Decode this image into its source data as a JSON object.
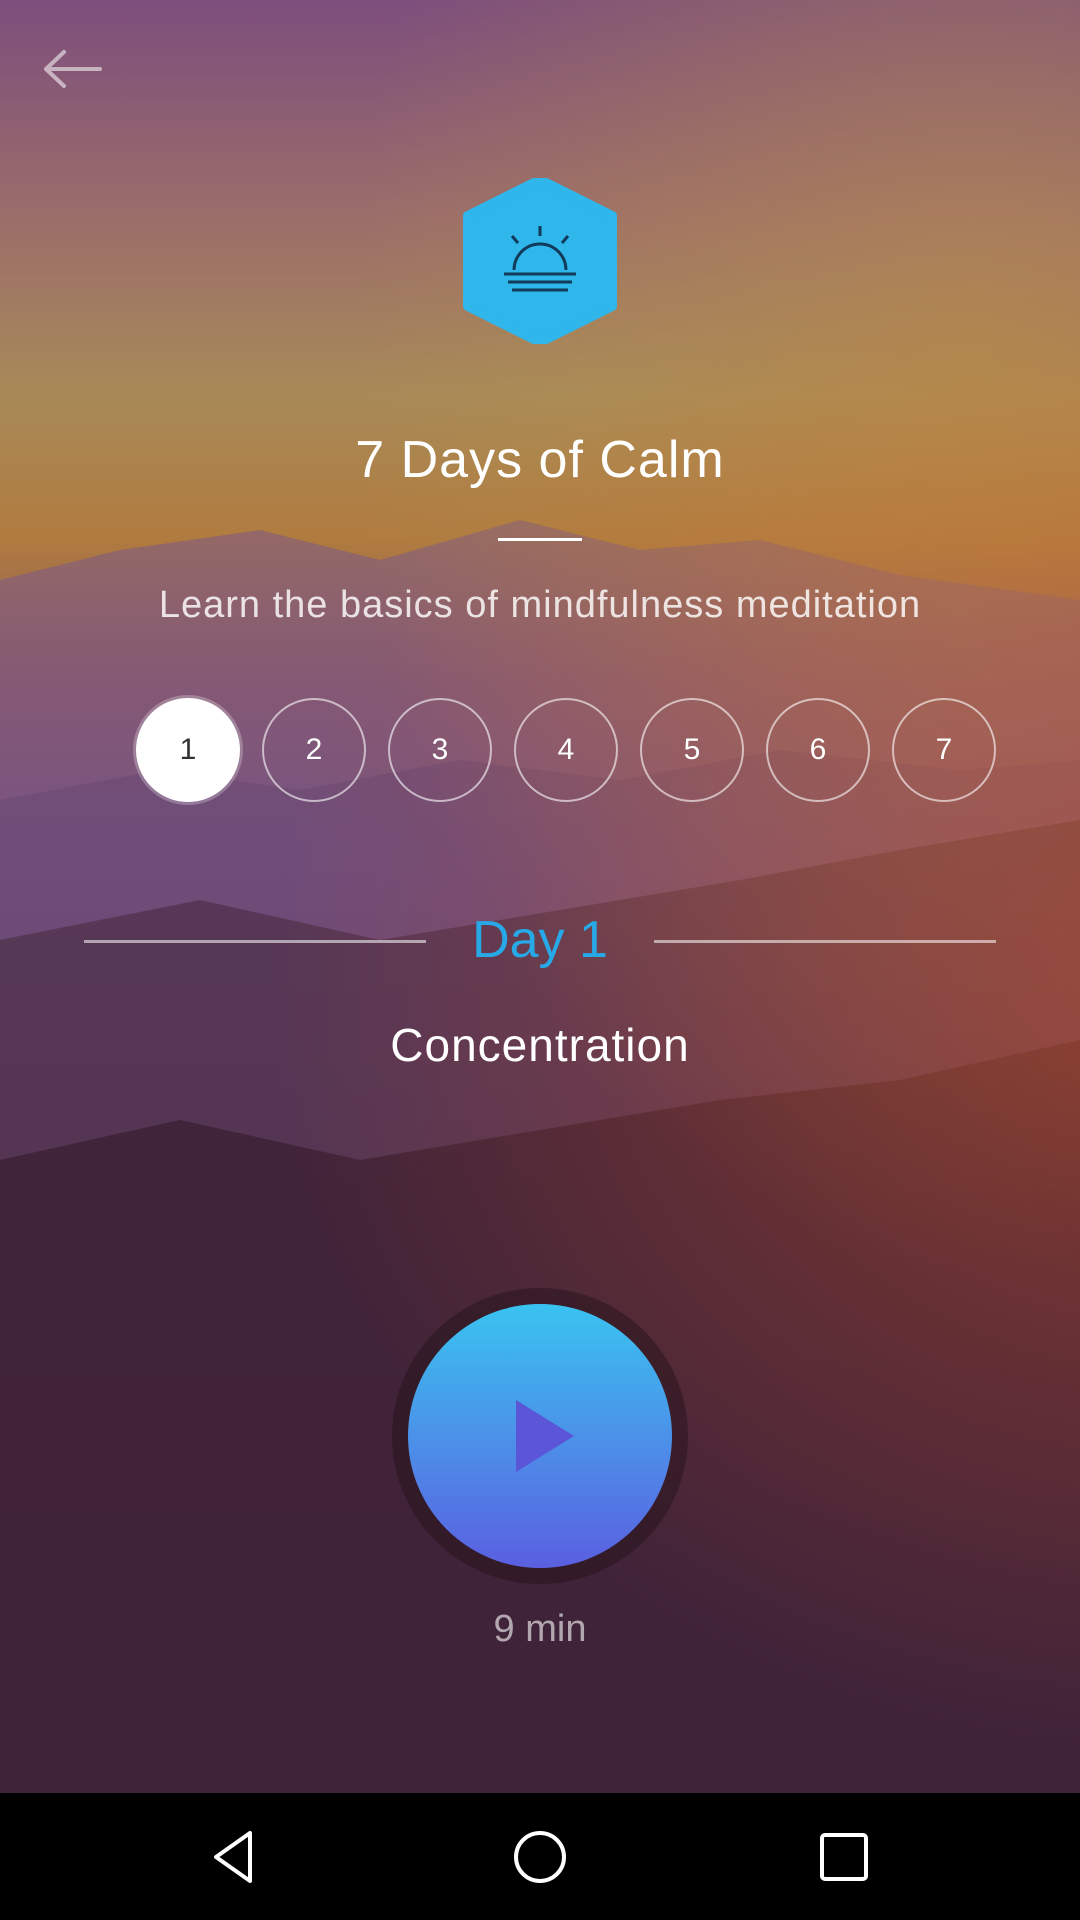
{
  "header": {
    "back_icon": "arrow-left-icon"
  },
  "program": {
    "logo_icon": "sunrise-icon",
    "title": "7 Days of Calm",
    "subtitle": "Learn the basics of mindfulness meditation"
  },
  "days": [
    {
      "label": "1",
      "active": true
    },
    {
      "label": "2",
      "active": false
    },
    {
      "label": "3",
      "active": false
    },
    {
      "label": "4",
      "active": false
    },
    {
      "label": "5",
      "active": false
    },
    {
      "label": "6",
      "active": false
    },
    {
      "label": "7",
      "active": false
    }
  ],
  "session": {
    "day_label": "Day 1",
    "name": "Concentration",
    "duration": "9 min",
    "play_icon": "play-icon"
  },
  "navbar": {
    "back_icon": "nav-back-icon",
    "home_icon": "nav-home-icon",
    "recents_icon": "nav-recents-icon"
  },
  "colors": {
    "accent": "#27a9e8",
    "logo": "#2fb6ea",
    "play_top": "#39c3f0",
    "play_bottom": "#5a5fe0"
  }
}
